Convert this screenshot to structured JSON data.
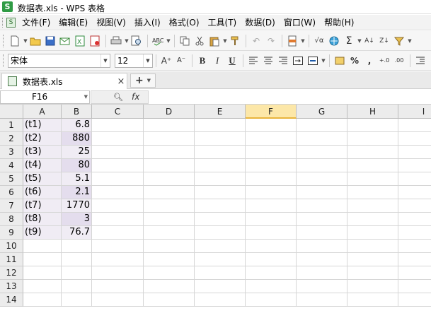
{
  "window": {
    "title": "数据表.xls - WPS 表格",
    "app_logo": "S"
  },
  "menubar": {
    "items": [
      "文件(F)",
      "编辑(E)",
      "视图(V)",
      "插入(I)",
      "格式(O)",
      "工具(T)",
      "数据(D)",
      "窗口(W)",
      "帮助(H)"
    ]
  },
  "toolbar": {
    "font_name": "宋体",
    "font_size": "12",
    "bold": "B",
    "italic": "I",
    "underline": "U",
    "percent": "%",
    "sum": "Σ",
    "grow_font": "A⁺",
    "shrink_font": "A⁻"
  },
  "tabs": {
    "file_name": "数据表.xls",
    "close": "×",
    "new": "+"
  },
  "formula_bar": {
    "cell_ref": "F16",
    "fx": "fx",
    "formula": ""
  },
  "sheet": {
    "columns": [
      "A",
      "B",
      "C",
      "D",
      "E",
      "F",
      "G",
      "H",
      "I"
    ],
    "selected_column": "F",
    "rows": [
      "1",
      "2",
      "3",
      "4",
      "5",
      "6",
      "7",
      "8",
      "9",
      "10",
      "11",
      "12",
      "13",
      "14"
    ],
    "data": [
      {
        "a": "(t1)",
        "b": "6.8"
      },
      {
        "a": "(t2)",
        "b": "880"
      },
      {
        "a": "(t3)",
        "b": "25"
      },
      {
        "a": "(t4)",
        "b": "80"
      },
      {
        "a": "(t5)",
        "b": "5.1"
      },
      {
        "a": "(t6)",
        "b": "2.1"
      },
      {
        "a": "(t7)",
        "b": "1770"
      },
      {
        "a": "(t8)",
        "b": "3"
      },
      {
        "a": "(t9)",
        "b": "76.7"
      }
    ]
  }
}
